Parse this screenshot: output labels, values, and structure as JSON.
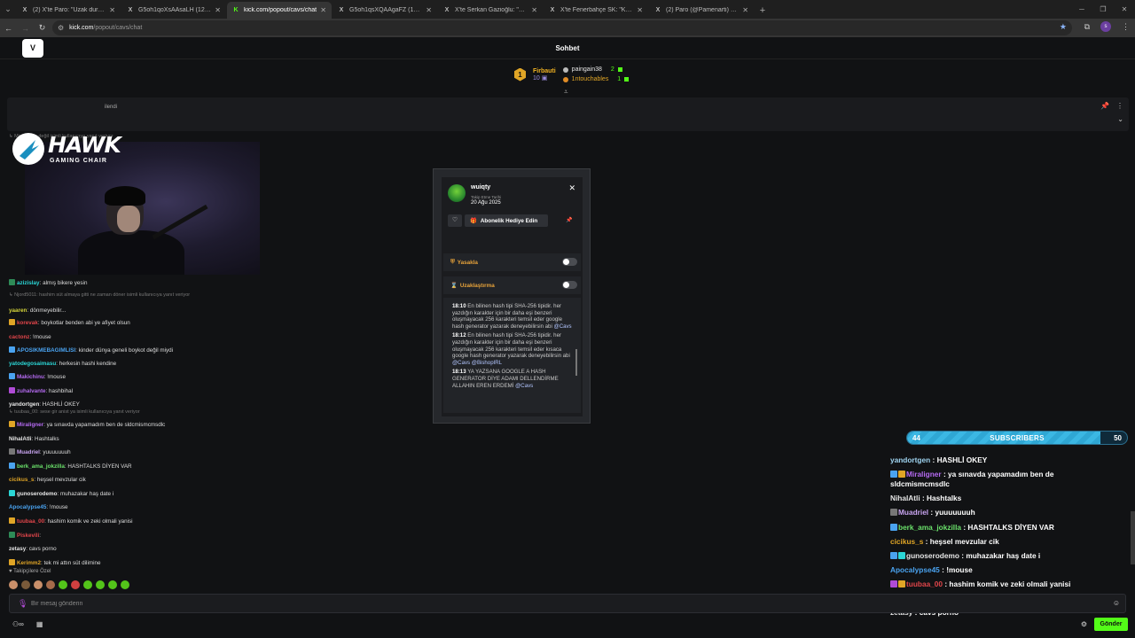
{
  "browser": {
    "tabs": [
      {
        "title": "(2) X'te Paro: \"Uzak durmak istiy",
        "favicon": "X",
        "active": false
      },
      {
        "title": "G5oh1qoXsAAsaLH (1200×354)",
        "favicon": "X",
        "active": false
      },
      {
        "title": "kick.com/popout/cavs/chat",
        "favicon": "K",
        "active": true
      },
      {
        "title": "G5oh1qsXQAAgaFZ (1200×311)",
        "favicon": "X",
        "active": false
      },
      {
        "title": "X'te Serkan Gazioğlu: \"Ee biz b",
        "favicon": "X",
        "active": false
      },
      {
        "title": "X'te Fenerbahçe SK: \"KAMUOY",
        "favicon": "X",
        "active": false
      },
      {
        "title": "(2) Paro (@Pamenarti) adlı kulla",
        "favicon": "X",
        "active": false
      }
    ],
    "url_host": "kick.com",
    "url_path": "/popout/cavs/chat",
    "profile_initial": "s"
  },
  "header": {
    "title": "Sohbet",
    "logo_text": "V"
  },
  "leaderboard": {
    "rank": "1",
    "first": {
      "name": "Firbauti",
      "count": "10"
    },
    "others": [
      {
        "name": "paingain38",
        "value": "2"
      },
      {
        "name": "1ntouchables",
        "value": "1"
      }
    ]
  },
  "pinned": {
    "text": "ilendi"
  },
  "hawk": {
    "word": "HAWK",
    "sub": "GAMING CHAIR"
  },
  "left_chat": [
    {
      "type": "reply",
      "text": "↳ Miraligner: değil isimli kullanıcıya yanıt veriyor",
      "top": 0
    },
    {
      "type": "reply",
      "text": "↳ Njord5011: hashim süt almaya gitti ne zaman döner isimli kullanıcıya yanıt veriyor",
      "top": 0
    }
  ],
  "left_messages": [
    {
      "user": "azizislay",
      "color": "#2bd6d6",
      "badge": "#2e8b57",
      "text": "almış bikere yesin"
    },
    {
      "user": "yaaren",
      "color": "#d4d43a",
      "badge": "",
      "text": "dönmeyebilir..."
    },
    {
      "user": "korevak",
      "color": "#e0454a",
      "badge": "#e0a526",
      "text": "boykotlar benden abi ye afiyet olsun"
    },
    {
      "user": "cactonz",
      "color": "#e0454a",
      "badge": "",
      "text": "!mouse"
    },
    {
      "user": "APOSIKMEBAGIMLISI",
      "color": "#4aa3f0",
      "badge": "#4aa3f0",
      "text": "kinder dünya geneli boykot değil miydi"
    },
    {
      "user": "yatodegosaimasu",
      "color": "#2bd6d6",
      "badge": "",
      "text": "herkesin hashi kendine"
    },
    {
      "user": "Makichinu",
      "color": "#b46af0",
      "badge": "#4aa3f0",
      "text": "!mouse"
    },
    {
      "user": "zuhalvante",
      "color": "#b46af0",
      "badge": "#b04bd6",
      "text": "hashbihal"
    },
    {
      "user": "yandortgen",
      "color": "#e6e6e6",
      "badge": "",
      "text": "HASHLİ OKEY"
    },
    {
      "user": "Miraligner",
      "color": "#b46af0",
      "badge": "#e0a526",
      "text": "ya sınavda yapamadım ben de sldcmismcmsdlc"
    },
    {
      "user": "NihalAtli",
      "color": "#e6e6e6",
      "badge": "",
      "text": "Hashtalks"
    },
    {
      "user": "Muadriel",
      "color": "#c8a4f0",
      "badge": "#777777",
      "text": "yuuuuuuuh"
    },
    {
      "user": "berk_ama_jokzilla",
      "color": "#6ae06a",
      "badge": "#4aa3f0",
      "text": "HASHTALKS DİYEN VAR"
    },
    {
      "user": "cicikus_s",
      "color": "#e0a526",
      "badge": "",
      "text": "heşsel mevzular cik"
    },
    {
      "user": "gunoserodemo",
      "color": "#e6e6e6",
      "badge": "#2bd6d6",
      "text": "muhazakar haş date i"
    },
    {
      "user": "Apocalypse45",
      "color": "#4aa3f0",
      "badge": "",
      "text": "!mouse"
    },
    {
      "user": "tuubaa_00",
      "color": "#e0454a",
      "badge": "#e0a526",
      "text": "hashim komik ve zeki olmali yanisi"
    },
    {
      "user": "Piskevili",
      "color": "#e0454a",
      "badge": "#2e8b57",
      "text": ""
    },
    {
      "user": "zetasy",
      "color": "#e6e6e6",
      "badge": "",
      "text": "cavs porno"
    },
    {
      "user": "Kerimm2",
      "color": "#e0a526",
      "badge": "#e0a526",
      "text": "tek mi attın süt dilimine"
    }
  ],
  "left_reply_3": "↳ tuubaa_00: sese gir anist ya isimli kullanıcıya yanıt veriyor",
  "user_card": {
    "username": "wuiqty",
    "follow_label": "Takip Etme Tarihi",
    "follow_date": "20 Ağu 2025",
    "gift_label": "Abonelik Hediye Edin",
    "ban_label": "Yasakla",
    "timeout_label": "Uzaklaştırma",
    "history": [
      {
        "time": "18:10",
        "text": "En bilinen hash tipi SHA-256 tipidir. her yazdığın karakter için bir daha eşi benzeri oluşmayacak 256 karakteri temsil eder google hash generator yazarak deneyebilirsin abi",
        "mention": "@Cavs"
      },
      {
        "time": "18:12",
        "text": "En bilinen hash tipi SHA-256 tipidir. her yazdığın karakter için bir daha eşi benzeri oluşmayacak 256 karakteri temsil eder kısaca google hash generator yazarak deneyebilirsin abi",
        "mention": "@Cavs @BishopIRL"
      },
      {
        "time": "18:13",
        "text": "YA YAZSANA GOOGLE A HASH GENERATOR DİYE ADAMI DELLENDİRME ALLAHIN EREN ERDEMİ",
        "mention": "@Cavs"
      }
    ]
  },
  "sub_goal": {
    "current": "44",
    "label": "SUBSCRIBERS",
    "target": "50",
    "progress": 0.88
  },
  "overlay_chat": [
    {
      "user": "yandortgen",
      "color": "#9fd4f0",
      "text": "HASHLİ OKEY",
      "badges": []
    },
    {
      "user": "Miraligner",
      "color": "#b46af0",
      "text": "ya sınavda yapamadım ben de",
      "badges": [
        "#4aa3f0",
        "#e0a526"
      ]
    },
    {
      "user": "",
      "color": "#fff",
      "text": "sldcmismcmsdlc",
      "badges": []
    },
    {
      "user": "NihalAtli",
      "color": "#e6e6e6",
      "text": "Hashtalks",
      "badges": []
    },
    {
      "user": "Muadriel",
      "color": "#c8a4f0",
      "text": "yuuuuuuuh",
      "badges": [
        "#777777"
      ]
    },
    {
      "user": "berk_ama_jokzilla",
      "color": "#6ae06a",
      "text": "HASHTALKS DİYEN VAR",
      "badges": [
        "#4aa3f0"
      ]
    },
    {
      "user": "cicikus_s",
      "color": "#e0a526",
      "text": "heşsel mevzular cik",
      "badges": []
    },
    {
      "user": "gunoserodemo",
      "color": "#e6e6e6",
      "text": "muhazakar haş date i",
      "badges": [
        "#4aa3f0",
        "#2bd6d6"
      ]
    },
    {
      "user": "Apocalypse45",
      "color": "#4aa3f0",
      "text": "!mouse",
      "badges": []
    },
    {
      "user": "tuubaa_00",
      "color": "#e0454a",
      "text": "hashim komik ve zeki olmali yanisi",
      "badges": [
        "#b04bd6",
        "#e0a526"
      ]
    },
    {
      "user": "Piskevili",
      "color": "#e0454a",
      "text": "",
      "badges": [
        "#2e8b57"
      ]
    },
    {
      "user": "zetasy",
      "color": "#e6e6e6",
      "text": "cavs porno",
      "badges": []
    }
  ],
  "footer": {
    "followers_only": "Takipçilere Özel",
    "input_placeholder": "Bir mesaj gönderin",
    "send_label": "Gönder"
  },
  "colors": {
    "kick_green": "#53fc18",
    "background": "#111214",
    "card": "#1b1c1f"
  }
}
